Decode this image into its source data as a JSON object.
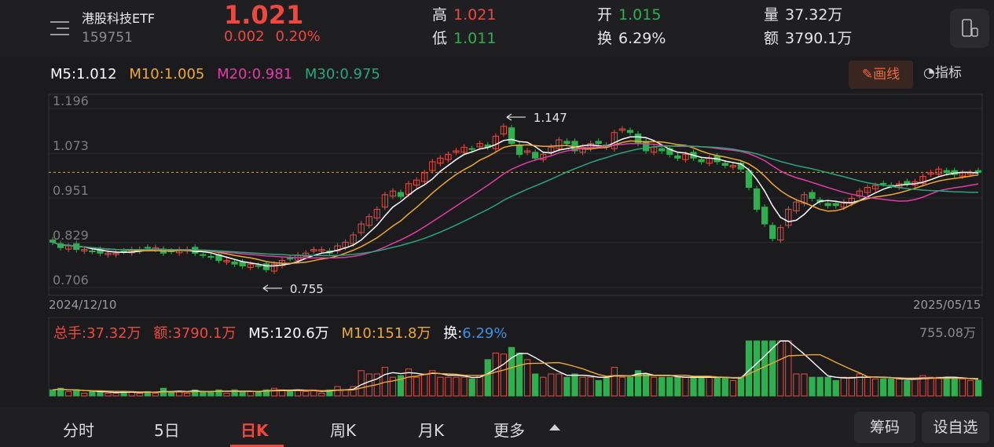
{
  "header": {
    "name": "港股科技ETF",
    "code": "159751",
    "price": "1.021",
    "change": "0.002",
    "change_pct": "0.20%",
    "high_label": "高",
    "high": "1.021",
    "low_label": "低",
    "low": "1.011",
    "open_label": "开",
    "open": "1.015",
    "turnover_label": "换",
    "turnover": "6.29%",
    "volume_label": "量",
    "volume": "37.32万",
    "amount_label": "额",
    "amount": "3790.1万"
  },
  "ma": {
    "m5": "M5:1.012",
    "m10": "M10:1.005",
    "m20": "M20:0.981",
    "m30": "M30:0.975"
  },
  "tools": {
    "draw_label": "画线",
    "indicator_label": "指标"
  },
  "chart": {
    "y_ticks": [
      "1.196",
      "1.073",
      "0.951",
      "0.829",
      "0.706"
    ],
    "max_marker": "1.147",
    "min_marker": "0.755",
    "start_date": "2024/12/10",
    "end_date": "2025/05/15"
  },
  "volume": {
    "total": "总手:37.32万",
    "amount": "额:3790.1万",
    "m5": "M5:120.6万",
    "m10": "M10:151.8万",
    "turnover_label": "换:",
    "turnover": "6.29%",
    "max": "755.08万"
  },
  "tabs": [
    "分时",
    "5日",
    "日K",
    "周K",
    "月K",
    "更多"
  ],
  "buttons": {
    "chips": "筹码",
    "settings": "设自选"
  },
  "colors": {
    "up": "#f0483e",
    "down": "#2db14f",
    "m5": "#ffffff",
    "m10": "#f0a830",
    "m20": "#e23ca8",
    "m30": "#2aa57a"
  },
  "chart_data": {
    "type": "candlestick",
    "x_range": [
      "2024/12/10",
      "2025/05/15"
    ],
    "ylim": [
      0.706,
      1.196
    ],
    "closes": [
      0.83,
      0.815,
      0.82,
      0.81,
      0.81,
      0.805,
      0.8,
      0.8,
      0.8,
      0.805,
      0.81,
      0.81,
      0.815,
      0.815,
      0.8,
      0.805,
      0.81,
      0.81,
      0.8,
      0.795,
      0.79,
      0.78,
      0.78,
      0.77,
      0.765,
      0.77,
      0.765,
      0.755,
      0.77,
      0.78,
      0.785,
      0.795,
      0.8,
      0.81,
      0.81,
      0.8,
      0.82,
      0.83,
      0.85,
      0.88,
      0.9,
      0.92,
      0.96,
      0.97,
      0.955,
      0.99,
      1.0,
      1.02,
      1.05,
      1.06,
      1.07,
      1.08,
      1.09,
      1.085,
      1.1,
      1.09,
      1.12,
      1.147,
      1.1,
      1.07,
      1.08,
      1.06,
      1.07,
      1.09,
      1.11,
      1.1,
      1.08,
      1.09,
      1.1,
      1.1,
      1.09,
      1.13,
      1.14,
      1.13,
      1.1,
      1.08,
      1.09,
      1.08,
      1.07,
      1.06,
      1.07,
      1.06,
      1.05,
      1.06,
      1.05,
      1.04,
      1.04,
      1.03,
      0.98,
      0.92,
      0.88,
      0.84,
      0.87,
      0.92,
      0.94,
      0.96,
      0.95,
      0.94,
      0.93,
      0.93,
      0.94,
      0.95,
      0.97,
      0.98,
      0.985,
      0.99,
      0.985,
      0.99,
      0.99,
      0.995,
      1.01,
      1.02,
      1.03,
      1.02,
      1.015,
      1.02,
      1.02,
      1.021
    ],
    "volume_max": "755.08万"
  }
}
